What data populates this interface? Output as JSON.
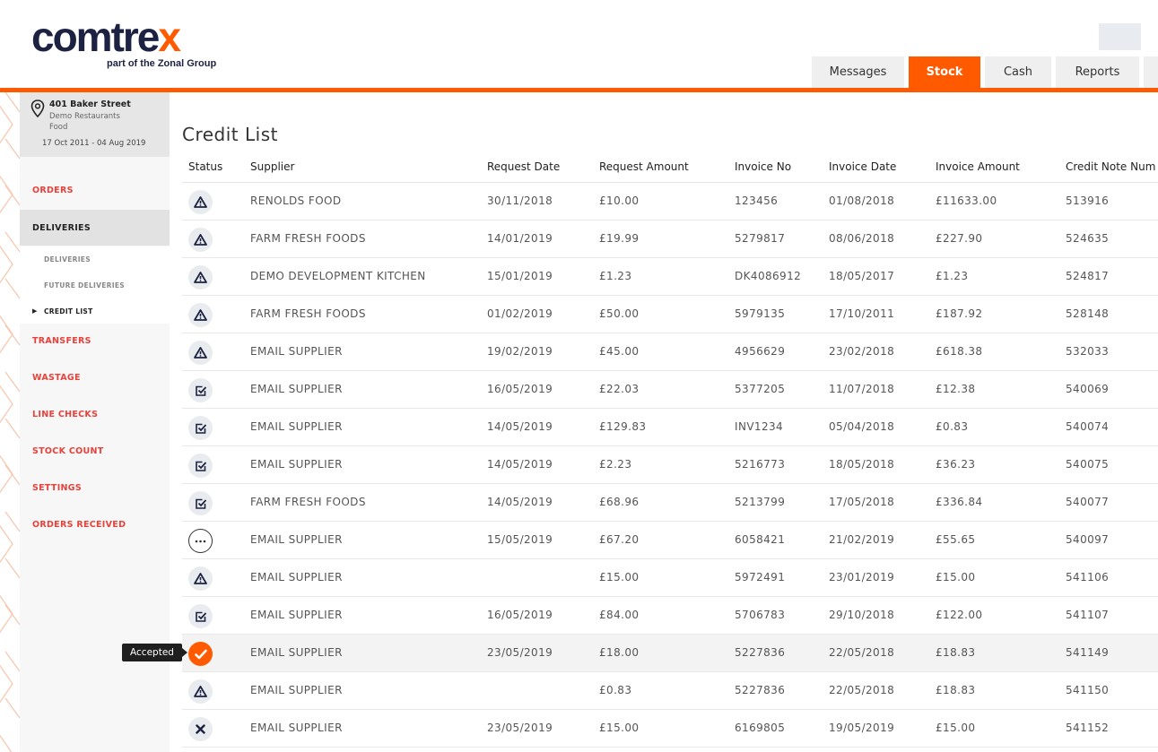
{
  "brand": {
    "logo_main": "comtre",
    "logo_x": "x",
    "tagline": "part of the Zonal Group"
  },
  "tabs": [
    {
      "label": "Messages",
      "active": false
    },
    {
      "label": "Stock",
      "active": true
    },
    {
      "label": "Cash",
      "active": false
    },
    {
      "label": "Reports",
      "active": false
    }
  ],
  "colors": {
    "accent": "#ff5a00",
    "brand_navy": "#1d2242",
    "nav_red": "#e8413a"
  },
  "location": {
    "name": "401 Baker Street",
    "line1": "Demo Restaurants",
    "line2": "Food",
    "date_range": "17 Oct 2011 - 04 Aug 2019"
  },
  "nav": {
    "orders": "ORDERS",
    "deliveries": "DELIVERIES",
    "sub_deliveries": "DELIVERIES",
    "sub_future": "FUTURE DELIVERIES",
    "sub_credit": "CREDIT LIST",
    "transfers": "TRANSFERS",
    "wastage": "WASTAGE",
    "line_checks": "LINE CHECKS",
    "stock_count": "STOCK COUNT",
    "settings": "SETTINGS",
    "orders_received": "ORDERS RECEIVED"
  },
  "page": {
    "title": "Credit List"
  },
  "table": {
    "headers": {
      "status": "Status",
      "supplier": "Supplier",
      "request_date": "Request Date",
      "request_amount": "Request Amount",
      "invoice_no": "Invoice No",
      "invoice_date": "Invoice Date",
      "invoice_amount": "Invoice Amount",
      "credit_note": "Credit Note Num"
    },
    "rows": [
      {
        "status": "warning-icon",
        "supplier": "RENOLDS FOOD",
        "request_date": "30/11/2018",
        "request_amount": "£10.00",
        "invoice_no": "123456",
        "invoice_date": "01/08/2018",
        "invoice_amount": "£11633.00",
        "credit_note": "513916"
      },
      {
        "status": "warning-icon",
        "supplier": "FARM FRESH FOODS",
        "request_date": "14/01/2019",
        "request_amount": "£19.99",
        "invoice_no": "5279817",
        "invoice_date": "08/06/2018",
        "invoice_amount": "£227.90",
        "credit_note": "524635"
      },
      {
        "status": "warning-icon",
        "supplier": "DEMO DEVELOPMENT KITCHEN",
        "request_date": "15/01/2019",
        "request_amount": "£1.23",
        "invoice_no": "DK4086912",
        "invoice_date": "18/05/2017",
        "invoice_amount": "£1.23",
        "credit_note": "524817"
      },
      {
        "status": "warning-icon",
        "supplier": "FARM FRESH FOODS",
        "request_date": "01/02/2019",
        "request_amount": "£50.00",
        "invoice_no": "5979135",
        "invoice_date": "17/10/2011",
        "invoice_amount": "£187.92",
        "credit_note": "528148"
      },
      {
        "status": "warning-icon",
        "supplier": "EMAIL SUPPLIER",
        "request_date": "19/02/2019",
        "request_amount": "£45.00",
        "invoice_no": "4956629",
        "invoice_date": "23/02/2018",
        "invoice_amount": "£618.38",
        "credit_note": "532033"
      },
      {
        "status": "checkbox-icon",
        "supplier": "EMAIL SUPPLIER",
        "request_date": "16/05/2019",
        "request_amount": "£22.03",
        "invoice_no": "5377205",
        "invoice_date": "11/07/2018",
        "invoice_amount": "£12.38",
        "credit_note": "540069"
      },
      {
        "status": "checkbox-icon",
        "supplier": "EMAIL SUPPLIER",
        "request_date": "14/05/2019",
        "request_amount": "£129.83",
        "invoice_no": "INV1234",
        "invoice_date": "05/04/2018",
        "invoice_amount": "£0.83",
        "credit_note": "540074"
      },
      {
        "status": "checkbox-icon",
        "supplier": "EMAIL SUPPLIER",
        "request_date": "14/05/2019",
        "request_amount": "£2.23",
        "invoice_no": "5216773",
        "invoice_date": "18/05/2018",
        "invoice_amount": "£36.23",
        "credit_note": "540075"
      },
      {
        "status": "checkbox-icon",
        "supplier": "FARM FRESH FOODS",
        "request_date": "14/05/2019",
        "request_amount": "£68.96",
        "invoice_no": "5213799",
        "invoice_date": "17/05/2018",
        "invoice_amount": "£336.84",
        "credit_note": "540077"
      },
      {
        "status": "pending-icon",
        "supplier": "EMAIL SUPPLIER",
        "request_date": "15/05/2019",
        "request_amount": "£67.20",
        "invoice_no": "6058421",
        "invoice_date": "21/02/2019",
        "invoice_amount": "£55.65",
        "credit_note": "540097"
      },
      {
        "status": "warning-icon",
        "supplier": "EMAIL SUPPLIER",
        "request_date": "",
        "request_amount": "£15.00",
        "invoice_no": "5972491",
        "invoice_date": "23/01/2019",
        "invoice_amount": "£15.00",
        "credit_note": "541106"
      },
      {
        "status": "checkbox-icon",
        "supplier": "EMAIL SUPPLIER",
        "request_date": "16/05/2019",
        "request_amount": "£84.00",
        "invoice_no": "5706783",
        "invoice_date": "29/10/2018",
        "invoice_amount": "£122.00",
        "credit_note": "541107"
      },
      {
        "status": "accepted-icon",
        "supplier": "EMAIL SUPPLIER",
        "request_date": "23/05/2019",
        "request_amount": "£18.00",
        "invoice_no": "5227836",
        "invoice_date": "22/05/2018",
        "invoice_amount": "£18.83",
        "credit_note": "541149"
      },
      {
        "status": "warning-icon",
        "supplier": "EMAIL SUPPLIER",
        "request_date": "",
        "request_amount": "£0.83",
        "invoice_no": "5227836",
        "invoice_date": "22/05/2018",
        "invoice_amount": "£18.83",
        "credit_note": "541150"
      },
      {
        "status": "rejected-icon",
        "supplier": "EMAIL SUPPLIER",
        "request_date": "23/05/2019",
        "request_amount": "£15.00",
        "invoice_no": "6169805",
        "invoice_date": "19/05/2019",
        "invoice_amount": "£15.00",
        "credit_note": "541152"
      }
    ]
  },
  "tooltip": {
    "label": "Accepted"
  }
}
